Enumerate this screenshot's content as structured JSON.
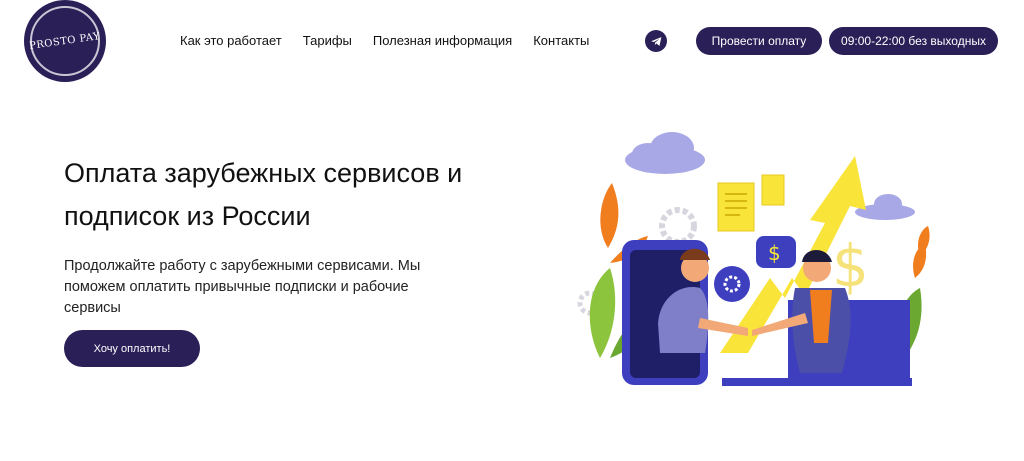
{
  "logo": {
    "text": "PROSTO PAY"
  },
  "nav": {
    "items": [
      {
        "label": "Как это работает"
      },
      {
        "label": "Тарифы"
      },
      {
        "label": "Полезная информация"
      },
      {
        "label": "Контакты"
      }
    ]
  },
  "header": {
    "pay_button": "Провести оплату",
    "hours_button": "09:00-22:00 без выходных"
  },
  "hero": {
    "title": "Оплата зарубежных сервисов и подписок из России",
    "subtitle": "Продолжайте работу с зарубежными сервисами. Мы поможем оплатить привычные подписки и рабочие сервисы",
    "cta_button": "Хочу оплатить!"
  },
  "colors": {
    "brand": "#2b1f57",
    "accent_yellow": "#f9e43a",
    "accent_orange": "#f07d1e",
    "illustration_blue": "#3d3fbf"
  },
  "icons": [
    "telegram-icon",
    "handshake-illustration"
  ]
}
